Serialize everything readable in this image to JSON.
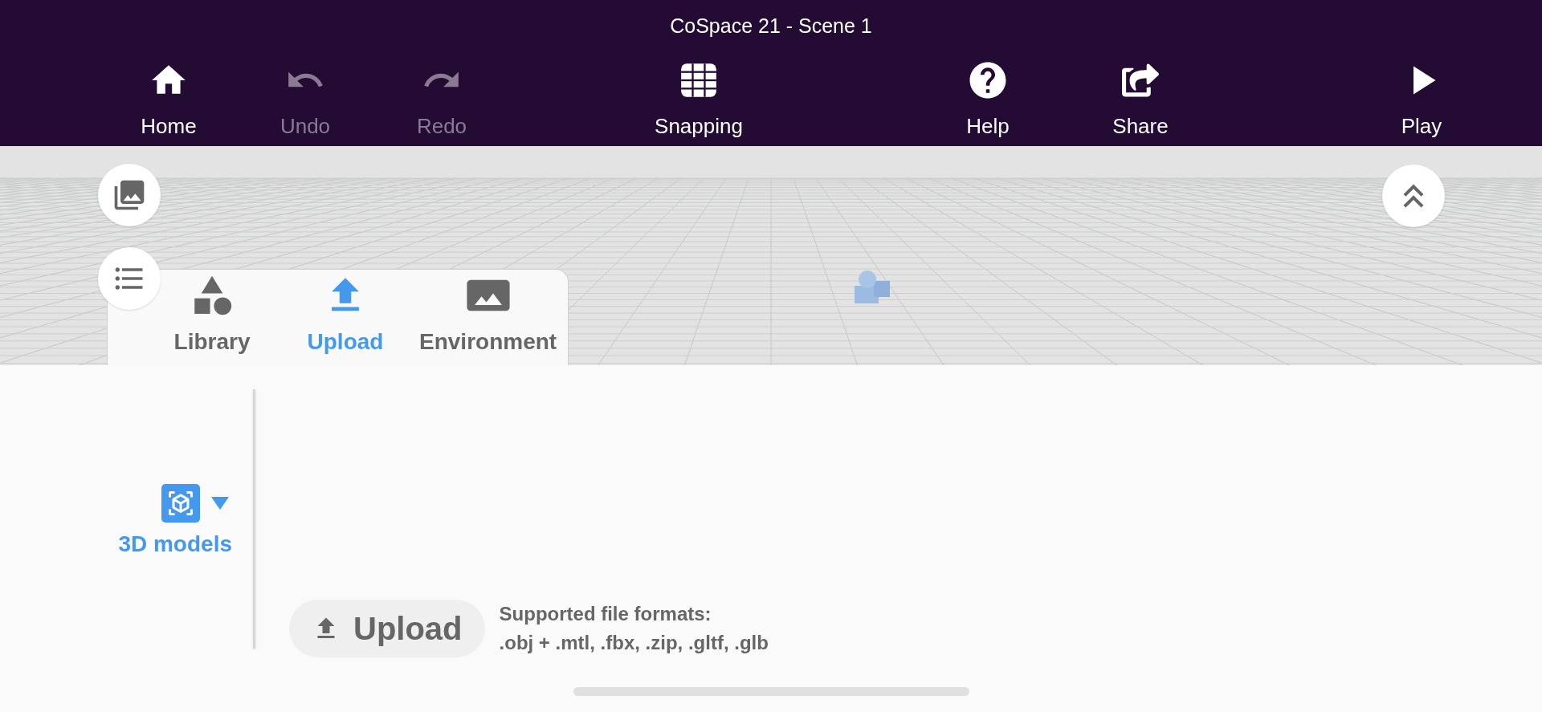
{
  "window": {
    "title": "CoSpace 21 - Scene 1"
  },
  "toolbar": [
    {
      "kind": "home",
      "label": "Home",
      "disabled": false
    },
    {
      "kind": "undo",
      "label": "Undo",
      "disabled": true
    },
    {
      "kind": "redo",
      "label": "Redo",
      "disabled": true
    },
    {
      "kind": "snapping",
      "label": "Snapping",
      "disabled": false
    },
    {
      "kind": "help",
      "label": "Help",
      "disabled": false
    },
    {
      "kind": "share",
      "label": "Share",
      "disabled": false
    },
    {
      "kind": "play",
      "label": "Play",
      "disabled": false
    }
  ],
  "tabs": [
    {
      "kind": "library",
      "label": "Library",
      "selected": false
    },
    {
      "kind": "upload",
      "label": "Upload",
      "selected": true
    },
    {
      "kind": "environment",
      "label": "Environment",
      "selected": false
    }
  ],
  "category": {
    "label": "3D models",
    "selected": true
  },
  "upload": {
    "button": "Upload",
    "formats_title": "Supported file formats:",
    "formats": ".obj + .mtl, .fbx, .zip, .gltf, .glb"
  }
}
